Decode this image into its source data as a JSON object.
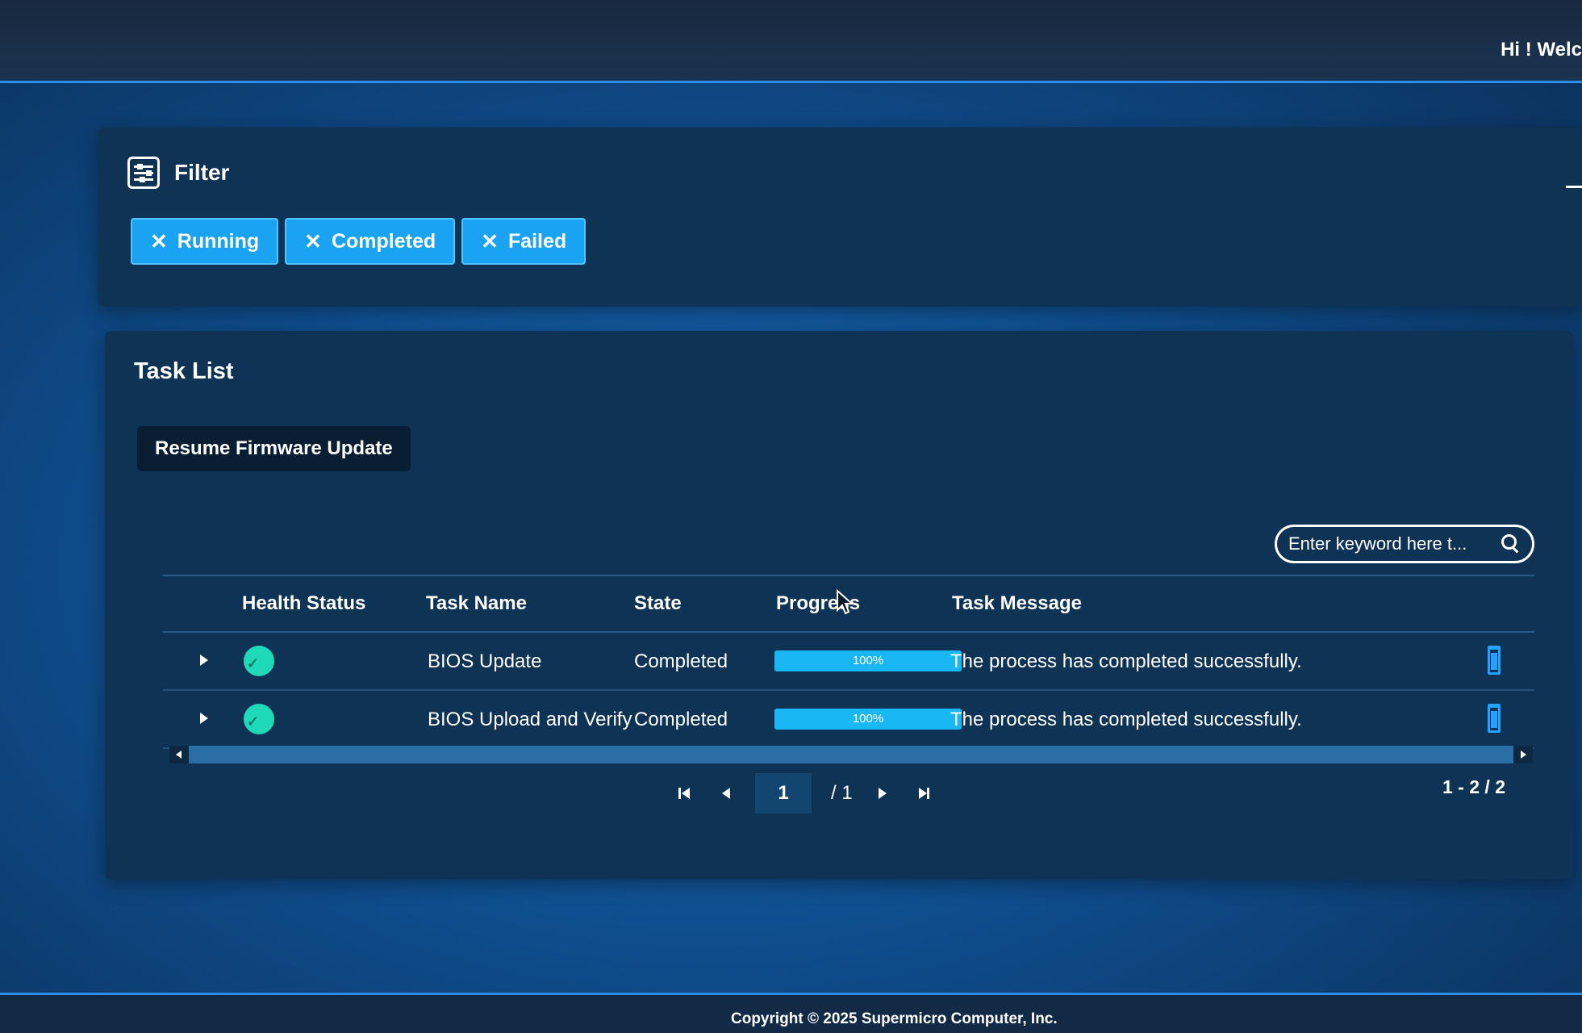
{
  "header": {
    "welcome": "Hi ! Welc"
  },
  "filter": {
    "title": "Filter",
    "chips": [
      "Running",
      "Completed",
      "Failed"
    ],
    "chip_remove_glyph": "✕"
  },
  "task_list": {
    "title": "Task List",
    "resume_label": "Resume Firmware Update",
    "search_placeholder": "Enter keyword here t...",
    "columns": {
      "health": "Health Status",
      "name": "Task Name",
      "state": "State",
      "progress": "Progress",
      "message": "Task Message"
    },
    "rows": [
      {
        "health": "ok",
        "name": "BIOS Update",
        "state": "Completed",
        "progress": 100,
        "progress_label": "100%",
        "message": "The process has completed successfully."
      },
      {
        "health": "ok",
        "name": "BIOS Upload and Verify",
        "state": "Completed",
        "progress": 100,
        "progress_label": "100%",
        "message": "The process has completed successfully."
      }
    ],
    "pager": {
      "page": "1",
      "total_label": "/ 1",
      "range": "1 - 2 / 2"
    }
  },
  "footer": {
    "copyright": "Copyright © 2025 Supermicro Computer, Inc."
  },
  "colors": {
    "accent": "#1aa3f2",
    "health_ok": "#20d9b8",
    "panel": "#0e3355"
  },
  "icons": [
    "filter-icon",
    "search-icon",
    "trash-icon",
    "chevron-right-icon",
    "first-page-icon",
    "prev-page-icon",
    "next-page-icon",
    "last-page-icon"
  ]
}
